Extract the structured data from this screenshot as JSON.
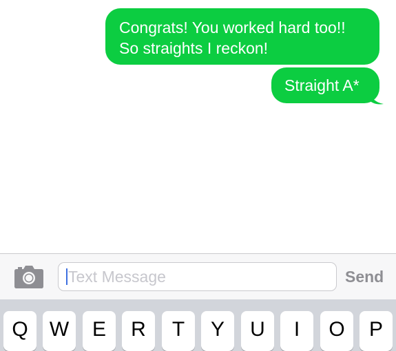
{
  "colors": {
    "bubble": "#0ccd41",
    "bubble_text": "#ffffff",
    "placeholder": "#c7c7cd",
    "send": "#8e8e93",
    "caret": "#3d6fe0",
    "keyboard_bg": "#d2d5db"
  },
  "messages": [
    {
      "lines": [
        "Congrats! You worked hard too!!",
        "So straights I reckon!"
      ]
    },
    {
      "lines": [
        "Straight A*"
      ]
    }
  ],
  "input_bar": {
    "camera_icon": "camera-icon",
    "placeholder": "Text Message",
    "send_label": "Send"
  },
  "keyboard": {
    "row1": [
      "Q",
      "W",
      "E",
      "R",
      "T",
      "Y",
      "U",
      "I",
      "O",
      "P"
    ]
  }
}
